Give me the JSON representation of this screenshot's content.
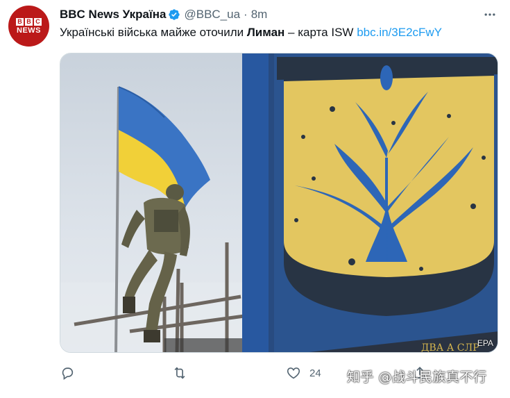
{
  "tweet": {
    "avatar": {
      "blocks": [
        "B",
        "B",
        "C"
      ],
      "word": "NEWS"
    },
    "display_name": "BBC News Україна",
    "handle": "@BBC_ua",
    "separator": "·",
    "time": "8m",
    "text_before": "Українські війська майже оточили ",
    "text_bold": "Лиман",
    "text_after": " – карта ISW ",
    "link": "bbc.in/3E2cFwY",
    "image": {
      "photo_credit": "EPA",
      "sign_text": "ДВА А СЛР"
    },
    "actions": {
      "reply": {
        "icon": "reply-icon"
      },
      "retweet": {
        "icon": "retweet-icon"
      },
      "like": {
        "icon": "heart-icon",
        "count": "24"
      },
      "share": {
        "icon": "share-icon"
      }
    }
  },
  "watermark": "知乎 @战斗民族真不行",
  "colors": {
    "bbc_red": "#bb1919",
    "verified_blue": "#1d9bf0",
    "link_blue": "#1d9bf0",
    "secondary_text": "#536471",
    "flag_blue": "#3a74c4",
    "flag_yellow": "#f1d038",
    "sign_yellow": "#e3c660",
    "sign_blue": "#2d66b7",
    "sign_dark": "#283444"
  }
}
